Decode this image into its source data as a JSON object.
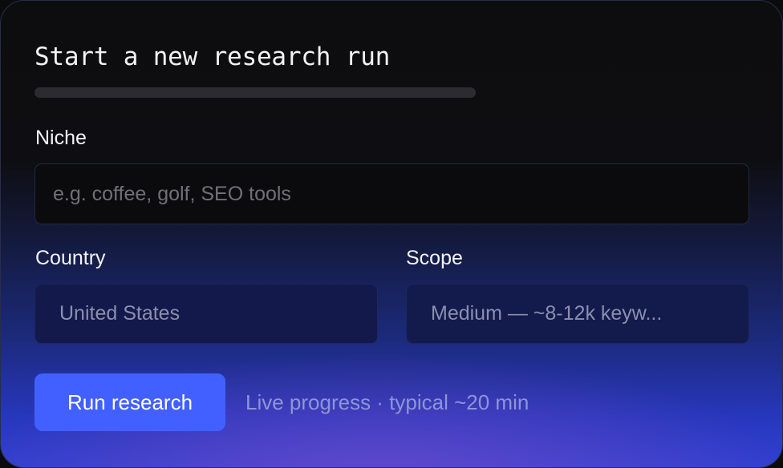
{
  "form": {
    "title": "Start a new research run",
    "progress_fraction": 0.0,
    "niche": {
      "label": "Niche",
      "placeholder": "e.g. coffee, golf, SEO tools",
      "value": ""
    },
    "country": {
      "label": "Country",
      "value": "United States"
    },
    "scope": {
      "label": "Scope",
      "value": "Medium — ~8-12k keyw..."
    },
    "run_button_label": "Run research",
    "hint": "Live progress · typical ~20 min"
  },
  "colors": {
    "accent": "#4260ff",
    "hint_text": "#8d95d8"
  }
}
